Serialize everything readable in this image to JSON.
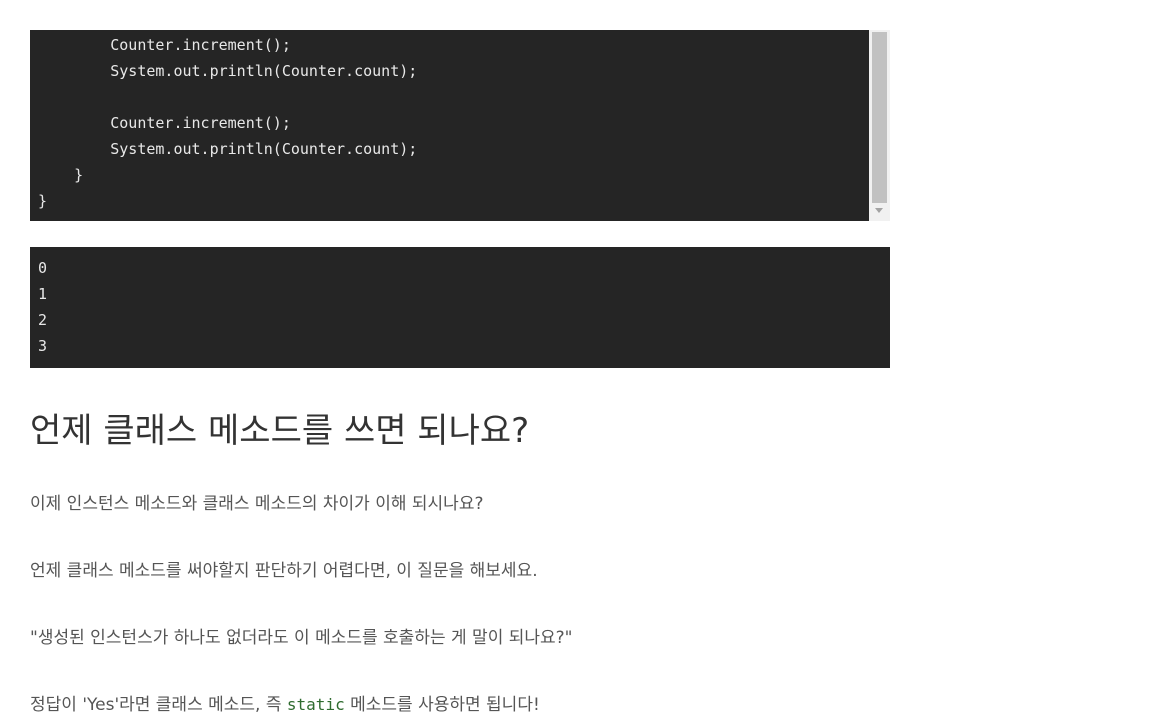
{
  "code_block": {
    "lines": [
      "        Counter.increment();",
      "        System.out.println(Counter.count);",
      "",
      "        Counter.increment();",
      "        System.out.println(Counter.count);",
      "    }",
      "}"
    ]
  },
  "output_block": {
    "lines": [
      "0",
      "1",
      "2",
      "3"
    ]
  },
  "article": {
    "heading": "언제 클래스 메소드를 쓰면 되나요?",
    "paragraphs": [
      "이제 인스턴스 메소드와 클래스 메소드의 차이가 이해 되시나요?",
      "언제 클래스 메소드를 써야할지 판단하기 어렵다면, 이 질문을 해보세요.",
      "\"생성된 인스턴스가 하나도 없더라도 이 메소드를 호출하는 게 말이 되나요?\""
    ],
    "last_paragraph": {
      "before": "정답이 'Yes'라면 클래스 메소드, 즉 ",
      "code": "static",
      "after": " 메소드를 사용하면 됩니다!"
    }
  },
  "colors": {
    "code_background": "#252525",
    "code_text": "#e8e8e8",
    "heading_text": "#333333",
    "body_text": "#555555",
    "inline_code": "#2f6b2f"
  }
}
